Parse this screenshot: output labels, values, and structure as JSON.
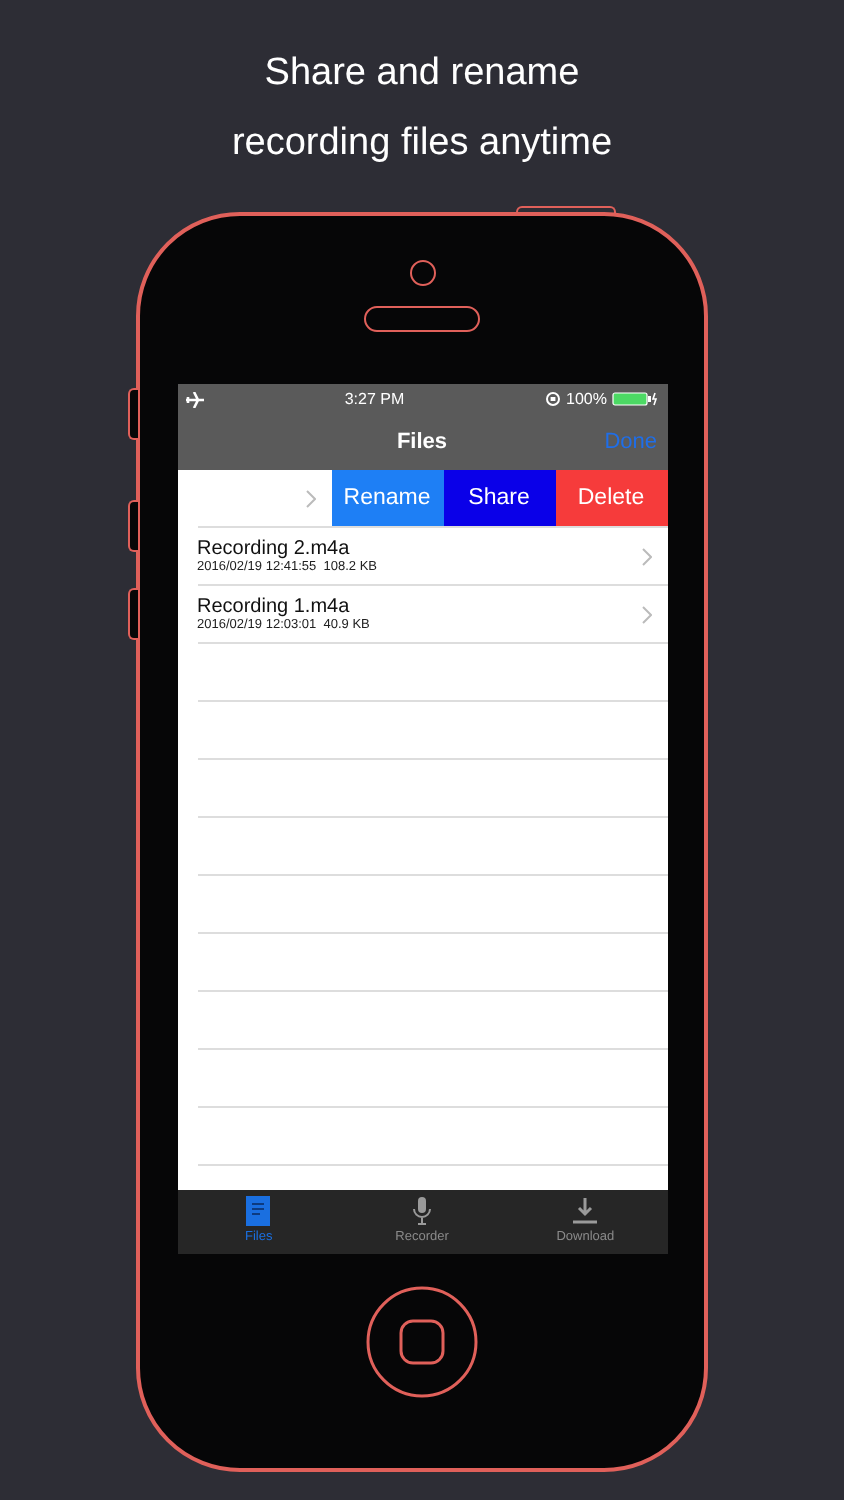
{
  "headline": [
    "Share and rename",
    "recording files anytime"
  ],
  "status_bar": {
    "time": "3:27 PM",
    "battery": "100%"
  },
  "nav": {
    "title": "Files",
    "action": "Done"
  },
  "swiped_row": {
    "actions": [
      {
        "label": "Rename",
        "color": "#1e7ff5"
      },
      {
        "label": "Share",
        "color": "#0a00e8"
      },
      {
        "label": "Delete",
        "color": "#f63b3b"
      }
    ]
  },
  "files": [
    {
      "name": "Recording 2.m4a",
      "details": "2016/02/19 12:41:55  108.2 KB"
    },
    {
      "name": "Recording 1.m4a",
      "details": "2016/02/19 12:03:01  40.9 KB"
    }
  ],
  "tabs": [
    {
      "label": "Files",
      "kind": "files",
      "selected": true
    },
    {
      "label": "Recorder",
      "kind": "recorder",
      "selected": false
    },
    {
      "label": "Download",
      "kind": "download",
      "selected": false
    }
  ]
}
